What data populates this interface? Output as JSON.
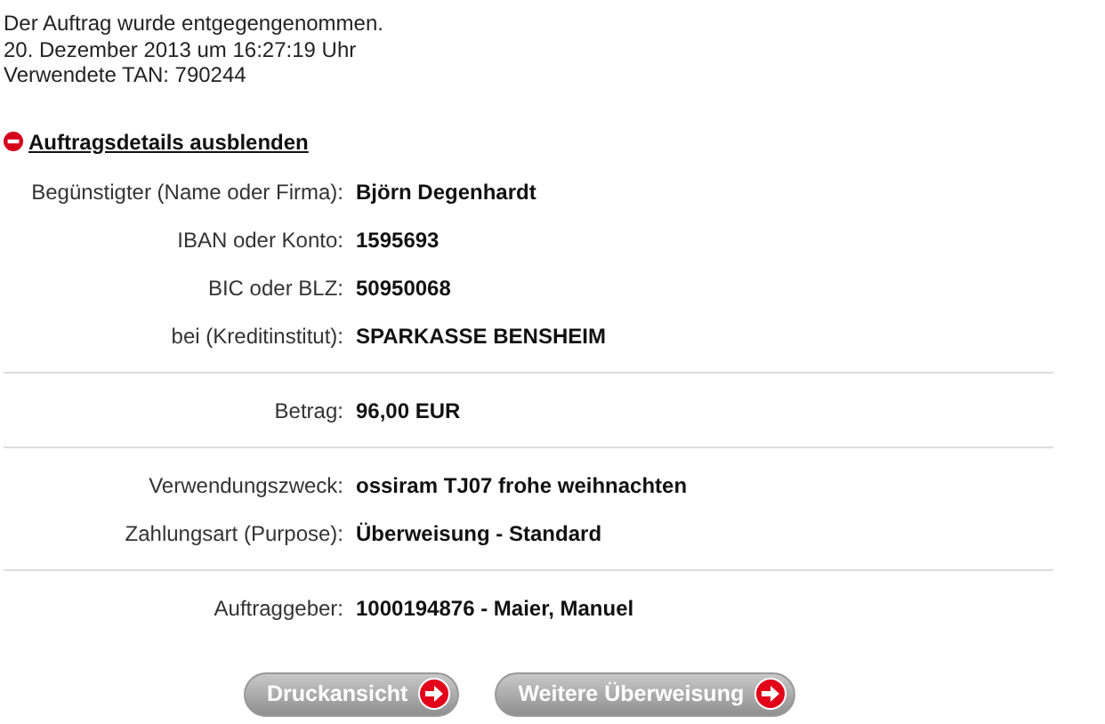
{
  "confirmation": [
    "Der Auftrag wurde entgegengenommen.",
    "20. Dezember 2013 um 16:27:19 Uhr",
    "Verwendete TAN: 790244"
  ],
  "toggle": {
    "label": "Auftragsdetails ausblenden",
    "expanded": true
  },
  "sections": [
    {
      "rows": [
        {
          "label": "Begünstigter (Name oder Firma):",
          "value": "Björn Degenhardt"
        },
        {
          "label": "IBAN oder Konto:",
          "value": "1595693"
        },
        {
          "label": "BIC oder BLZ:",
          "value": "50950068"
        },
        {
          "label": "bei (Kreditinstitut):",
          "value": "SPARKASSE BENSHEIM"
        }
      ]
    },
    {
      "rows": [
        {
          "label": "Betrag:",
          "value": "96,00 EUR"
        }
      ]
    },
    {
      "rows": [
        {
          "label": "Verwendungszweck:",
          "value": "ossiram TJ07 frohe weihnachten"
        },
        {
          "label": "Zahlungsart (Purpose):",
          "value": "Überweisung - Standard"
        }
      ]
    },
    {
      "rows": [
        {
          "label": "Auftraggeber:",
          "value": "1000194876 - Maier, Manuel"
        }
      ]
    }
  ],
  "buttons": [
    "Druckansicht",
    "Weitere Überweisung"
  ]
}
